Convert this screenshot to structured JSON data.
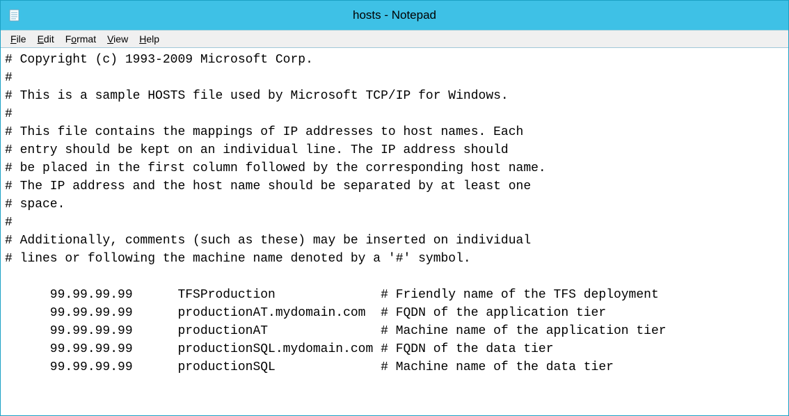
{
  "window": {
    "title": "hosts - Notepad"
  },
  "menu": {
    "file": {
      "u": "F",
      "rest": "ile"
    },
    "edit": {
      "u": "E",
      "rest": "dit"
    },
    "format": {
      "u": "o",
      "pre": "F",
      "rest": "rmat"
    },
    "view": {
      "u": "V",
      "rest": "iew"
    },
    "help": {
      "u": "H",
      "rest": "elp"
    }
  },
  "file_lines": [
    "# Copyright (c) 1993-2009 Microsoft Corp.",
    "#",
    "# This is a sample HOSTS file used by Microsoft TCP/IP for Windows.",
    "#",
    "# This file contains the mappings of IP addresses to host names. Each",
    "# entry should be kept on an individual line. The IP address should",
    "# be placed in the first column followed by the corresponding host name.",
    "# The IP address and the host name should be separated by at least one",
    "# space.",
    "#",
    "# Additionally, comments (such as these) may be inserted on individual",
    "# lines or following the machine name denoted by a '#' symbol.",
    "",
    "      99.99.99.99      TFSProduction              # Friendly name of the TFS deployment",
    "      99.99.99.99      productionAT.mydomain.com  # FQDN of the application tier",
    "      99.99.99.99      productionAT               # Machine name of the application tier",
    "      99.99.99.99      productionSQL.mydomain.com # FQDN of the data tier",
    "      99.99.99.99      productionSQL              # Machine name of the data tier"
  ]
}
